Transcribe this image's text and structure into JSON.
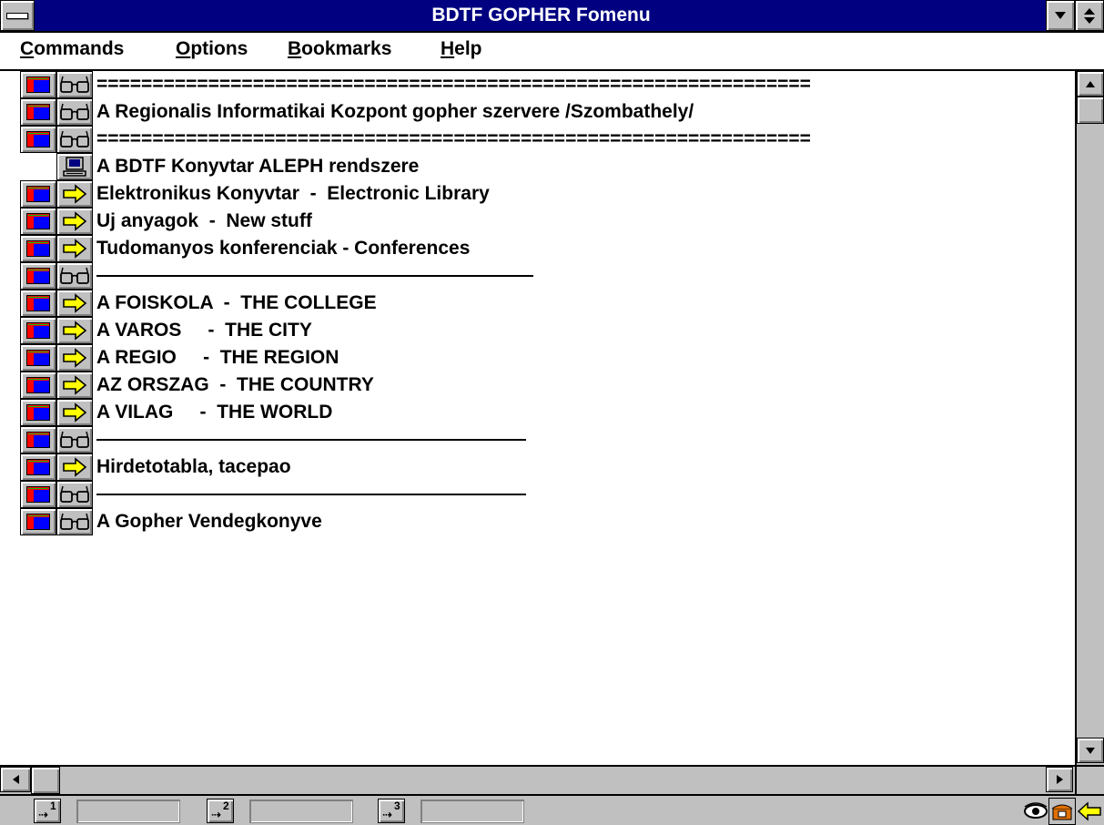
{
  "window": {
    "title": "BDTF GOPHER Fomenu"
  },
  "menu": {
    "items": [
      {
        "label": "Commands",
        "mnemonic": "C",
        "rest": "ommands"
      },
      {
        "label": "Options",
        "mnemonic": "O",
        "rest": "ptions"
      },
      {
        "label": "Bookmarks",
        "mnemonic": "B",
        "rest": "ookmarks"
      },
      {
        "label": "Help",
        "mnemonic": "H",
        "rest": "elp"
      }
    ]
  },
  "gopher_menu": {
    "items": [
      {
        "type": "text",
        "label": "================================================================"
      },
      {
        "type": "text",
        "label": "A Regionalis Informatikai Kozpont gopher szervere /Szombathely/"
      },
      {
        "type": "text",
        "label": "================================================================"
      },
      {
        "type": "telnet",
        "label": "A BDTF Konyvtar ALEPH rendszere"
      },
      {
        "type": "directory",
        "label": "Elektronikus Konyvtar  -  Electronic Library"
      },
      {
        "type": "directory",
        "label": "Uj anyagok  -  New stuff"
      },
      {
        "type": "directory",
        "label": "Tudomanyos konferenciak - Conferences"
      },
      {
        "type": "separator",
        "label": ""
      },
      {
        "type": "directory",
        "label": "A FOISKOLA  -  THE COLLEGE"
      },
      {
        "type": "directory",
        "label": "A VAROS     -  THE CITY"
      },
      {
        "type": "directory",
        "label": "A REGIO     -  THE REGION"
      },
      {
        "type": "directory",
        "label": "AZ ORSZAG  -  THE COUNTRY"
      },
      {
        "type": "directory",
        "label": "A VILAG     -  THE WORLD"
      },
      {
        "type": "separator",
        "label": ""
      },
      {
        "type": "directory",
        "label": "Hirdetotabla, tacepao"
      },
      {
        "type": "separator",
        "label": ""
      },
      {
        "type": "text",
        "label": "A Gopher Vendegkonyve"
      }
    ]
  },
  "statusbar": {
    "bookmark_buttons": [
      "1",
      "2",
      "3"
    ],
    "fields": [
      "",
      "",
      ""
    ],
    "right_icons": [
      "eye-icon",
      "phone-icon",
      "back-arrow-icon"
    ]
  },
  "colors": {
    "titlebar": "#000080",
    "chrome": "#c0c0c0",
    "arrow_icon": "#ffff00",
    "screen_red": "#ff0000",
    "screen_blue": "#0000ff"
  }
}
